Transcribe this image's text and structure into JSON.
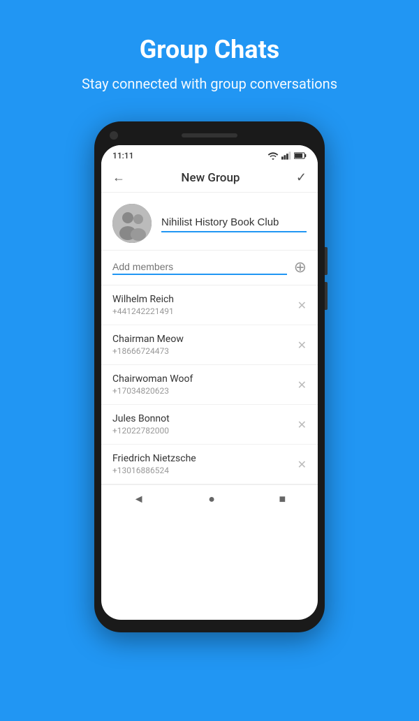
{
  "page": {
    "background_color": "#2196F3"
  },
  "header": {
    "title": "Group Chats",
    "subtitle": "Stay connected with group conversations"
  },
  "phone": {
    "status_bar": {
      "time": "11:11"
    },
    "app_bar": {
      "title": "New Group",
      "back_icon": "←",
      "confirm_icon": "✓"
    },
    "group_name_input": {
      "value": "Nihilist History Book Club",
      "placeholder": ""
    },
    "add_members": {
      "placeholder": "Add members"
    },
    "members": [
      {
        "name": "Wilhelm Reich",
        "phone": "+441242221491"
      },
      {
        "name": "Chairman Meow",
        "phone": "+18666724473"
      },
      {
        "name": "Chairwoman Woof",
        "phone": "+17034820623"
      },
      {
        "name": "Jules Bonnot",
        "phone": "+12022782000"
      },
      {
        "name": "Friedrich Nietzsche",
        "phone": "+13016886524"
      }
    ],
    "nav_bar": {
      "back_icon": "◄",
      "home_icon": "●",
      "recents_icon": "■"
    }
  }
}
